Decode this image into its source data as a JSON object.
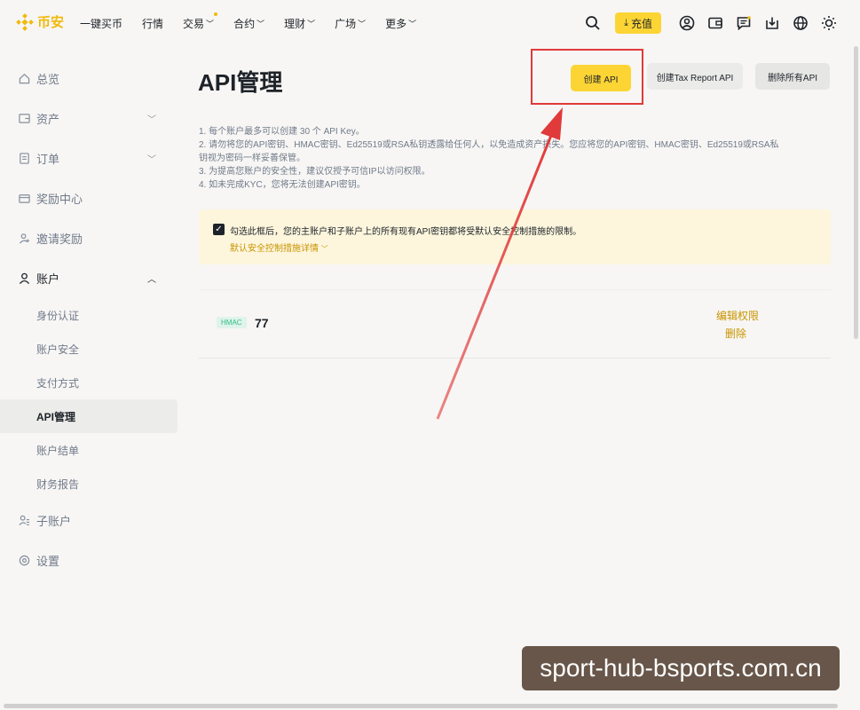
{
  "brand": {
    "name": "币安",
    "color": "#f0b90b"
  },
  "topnav": {
    "items": [
      {
        "label": "一键买币",
        "chevron": false,
        "dot": false
      },
      {
        "label": "行情",
        "chevron": false,
        "dot": false
      },
      {
        "label": "交易",
        "chevron": true,
        "dot": true
      },
      {
        "label": "合约",
        "chevron": true,
        "dot": false
      },
      {
        "label": "理财",
        "chevron": true,
        "dot": false
      },
      {
        "label": "广场",
        "chevron": true,
        "dot": false
      },
      {
        "label": "更多",
        "chevron": true,
        "dot": false
      }
    ],
    "deposit_label": "充值",
    "icons": [
      "search-icon",
      "deposit-icon",
      "profile-icon",
      "wallet-icon",
      "message-icon",
      "download-icon",
      "globe-icon",
      "theme-icon"
    ]
  },
  "sidebar": {
    "items": [
      {
        "label": "总览",
        "icon": "home-icon"
      },
      {
        "label": "资产",
        "icon": "wallet-icon"
      },
      {
        "label": "订单",
        "icon": "order-icon"
      },
      {
        "label": "奖励中心",
        "icon": "reward-icon"
      },
      {
        "label": "邀请奖励",
        "icon": "invite-icon"
      },
      {
        "label": "账户",
        "icon": "user-icon"
      },
      {
        "label": "子账户",
        "icon": "subaccount-icon"
      },
      {
        "label": "设置",
        "icon": "settings-icon"
      }
    ],
    "account_sub": [
      "身份认证",
      "账户安全",
      "支付方式",
      "API管理",
      "账户结单",
      "财务报告"
    ]
  },
  "main": {
    "title": "API管理",
    "create_api": "创建 API",
    "create_tax": "创建Tax Report API",
    "delete_all": "删除所有API",
    "notes": [
      "1. 每个账户最多可以创建 30 个 API Key。",
      "2. 请勿将您的API密钥、HMAC密钥、Ed25519或RSA私钥透露给任何人，以免造成资产损失。您应将您的API密钥、HMAC密钥、Ed25519或RSA私",
      "钥视为密码一样妥善保管。",
      "3. 为提高您账户的安全性，建议仅授予可信IP以访问权限。",
      "4. 如未完成KYC，您将无法创建API密钥。"
    ],
    "warning_text": "勾选此框后，您的主账户和子账户上的所有现有API密钥都将受默认安全控制措施的限制。",
    "warning_link": "默认安全控制措施详情",
    "key": {
      "badge": "HMAC",
      "name": "77",
      "edit": "编辑权限",
      "delete": "删除"
    }
  },
  "watermark": "sport-hub-bsports.com.cn"
}
